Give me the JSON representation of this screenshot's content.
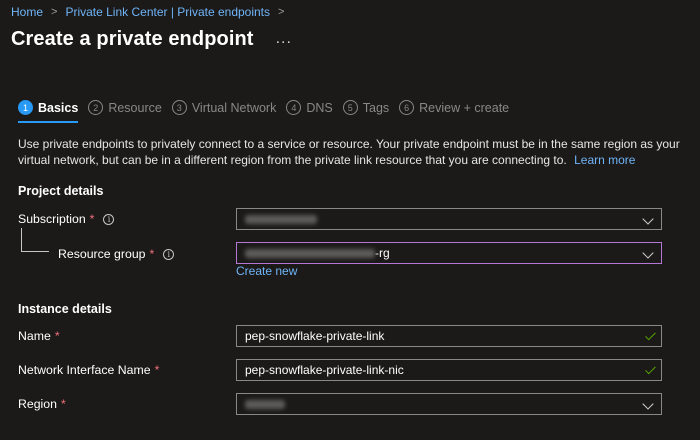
{
  "breadcrumb": {
    "items": [
      "Home",
      "Private Link Center | Private endpoints"
    ],
    "separator": ">"
  },
  "page": {
    "title": "Create a private endpoint",
    "more_label": "..."
  },
  "tabs": [
    {
      "step": "1",
      "label": "Basics",
      "active": true
    },
    {
      "step": "2",
      "label": "Resource"
    },
    {
      "step": "3",
      "label": "Virtual Network"
    },
    {
      "step": "4",
      "label": "DNS"
    },
    {
      "step": "5",
      "label": "Tags"
    },
    {
      "step": "6",
      "label": "Review + create"
    }
  ],
  "description": {
    "text": "Use private endpoints to privately connect to a service or resource. Your private endpoint must be in the same region as your virtual network, but can be in a different region from the private link resource that you are connecting to.",
    "learn_more": "Learn more"
  },
  "project_details": {
    "heading": "Project details",
    "subscription": {
      "label": "Subscription",
      "required_mark": "*",
      "info_glyph": "i"
    },
    "resource_group": {
      "label": "Resource group",
      "required_mark": "*",
      "info_glyph": "i",
      "value_suffix": "-rg",
      "create_new": "Create new"
    }
  },
  "instance_details": {
    "heading": "Instance details",
    "name": {
      "label": "Name",
      "required_mark": "*",
      "value": "pep-snowflake-private-link"
    },
    "nic_name": {
      "label": "Network Interface Name",
      "required_mark": "*",
      "value": "pep-snowflake-private-link-nic"
    },
    "region": {
      "label": "Region",
      "required_mark": "*"
    }
  },
  "colors": {
    "background": "#1b1a19",
    "link": "#6fb4f7",
    "accent": "#2899f5",
    "required": "#f1707b",
    "valid": "#57a300",
    "focus_border": "#b478d4"
  },
  "icons": {
    "dropdown": "chevron-down-icon",
    "valid": "checkmark-icon",
    "info": "info-icon",
    "more": "ellipsis-icon"
  }
}
